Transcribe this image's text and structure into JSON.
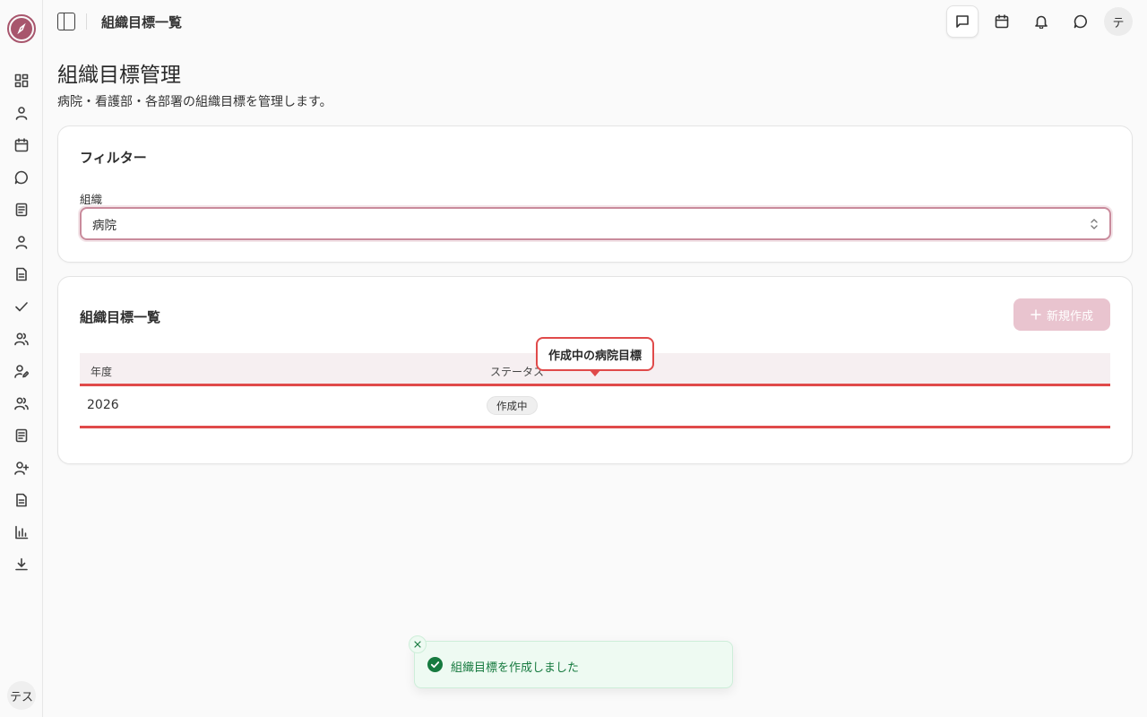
{
  "header": {
    "title": "組織目標一覧",
    "avatar_initial": "テ"
  },
  "sidebar": {
    "items": [
      {
        "icon": "dashboard-icon"
      },
      {
        "icon": "user-icon"
      },
      {
        "icon": "calendar-icon"
      },
      {
        "icon": "message-icon"
      },
      {
        "icon": "list-icon"
      },
      {
        "icon": "user-icon"
      },
      {
        "icon": "document-icon"
      },
      {
        "icon": "check-icon"
      },
      {
        "icon": "users-icon"
      },
      {
        "icon": "user-edit-icon"
      },
      {
        "icon": "users-icon"
      },
      {
        "icon": "list-icon"
      },
      {
        "icon": "user-plus-icon"
      },
      {
        "icon": "document-icon"
      },
      {
        "icon": "bar-chart-icon"
      },
      {
        "icon": "download-icon"
      }
    ],
    "user_initials": "テス"
  },
  "page": {
    "title": "組織目標管理",
    "description": "病院・看護部・各部署の組織目標を管理します。"
  },
  "filter": {
    "title": "フィルター",
    "org_label": "組織",
    "org_value": "病院"
  },
  "list": {
    "title": "組織目標一覧",
    "new_button": "新規作成",
    "columns": [
      "年度",
      "ステータス"
    ],
    "rows": [
      {
        "year": "2026",
        "status": "作成中"
      }
    ]
  },
  "tooltip": {
    "text": "作成中の病院目標"
  },
  "toast": {
    "message": "組織目標を作成しました"
  },
  "colors": {
    "brand": "#a8566d",
    "highlight": "#e04a4a",
    "success": "#167a3f"
  }
}
